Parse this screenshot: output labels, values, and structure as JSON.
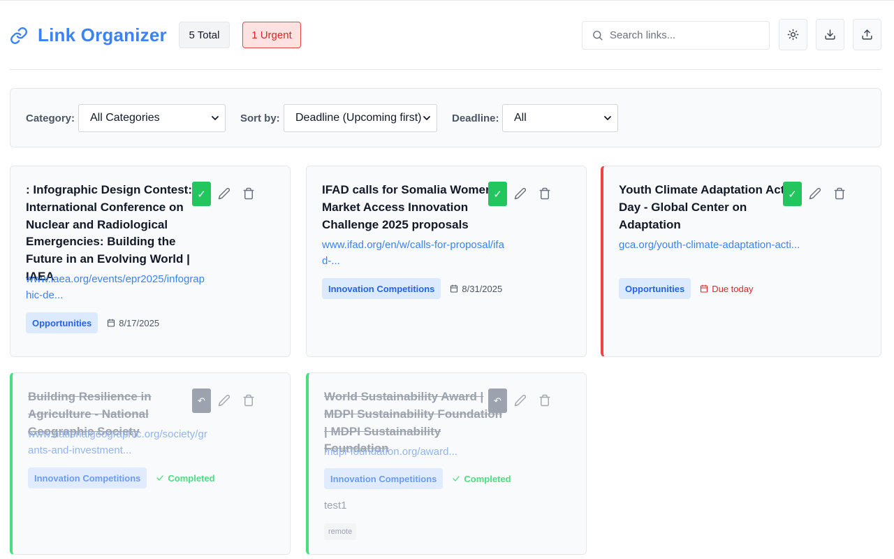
{
  "header": {
    "title": "Link Organizer",
    "total_badge": "5 Total",
    "urgent_badge": "1 Urgent",
    "search_placeholder": "Search links...",
    "buttons": {
      "theme": "sun-icon",
      "export": "download-icon",
      "import": "upload-icon"
    }
  },
  "filters": {
    "category_label": "Category:",
    "category_value": "All Categories",
    "sort_label": "Sort by:",
    "sort_value": "Deadline (Upcoming first)",
    "deadline_label": "Deadline:",
    "deadline_value": "All"
  },
  "colors": {
    "accent": "#3b82f6",
    "urgent": "#ef4444",
    "complete": "#22c55e",
    "completed_border": "#4ade80"
  },
  "cards": [
    {
      "title": ": Infographic Design Contest: International Conference on Nuclear and Radiological Emergencies: Building the Future in an Evolving World | IAEA",
      "url": "www.iaea.org/events/epr2025/infographic-de...",
      "category": "Opportunities",
      "date": "8/17/2025",
      "status": "open"
    },
    {
      "title": "IFAD calls for Somalia Women’s Market Access Innovation Challenge 2025 proposals",
      "url": "www.ifad.org/en/w/calls-for-proposal/ifad-...",
      "category": "Innovation Competitions",
      "date": "8/31/2025",
      "status": "open"
    },
    {
      "title": "Youth Climate Adaptation Action Day - Global Center on Adaptation",
      "url": "gca.org/youth-climate-adaptation-acti...",
      "category": "Opportunities",
      "date": "Due today",
      "status": "urgent"
    },
    {
      "title": "Building Resilience in Agriculture - National Geographic Society",
      "url": "www.nationalgeographic.org/society/grants-and-investment...",
      "category": "Innovation Competitions",
      "date": "Completed",
      "status": "completed"
    },
    {
      "title": "World Sustainability Award | MDPI Sustainability Foundation | MDPI Sustainability Foundation",
      "url": "mdpi-foundation.org/award...",
      "category": "Innovation Competitions",
      "date": "Completed",
      "status": "completed",
      "note": "test1",
      "tag": "remote"
    }
  ],
  "action_icons": {
    "complete": "✓",
    "undo": "↶"
  }
}
